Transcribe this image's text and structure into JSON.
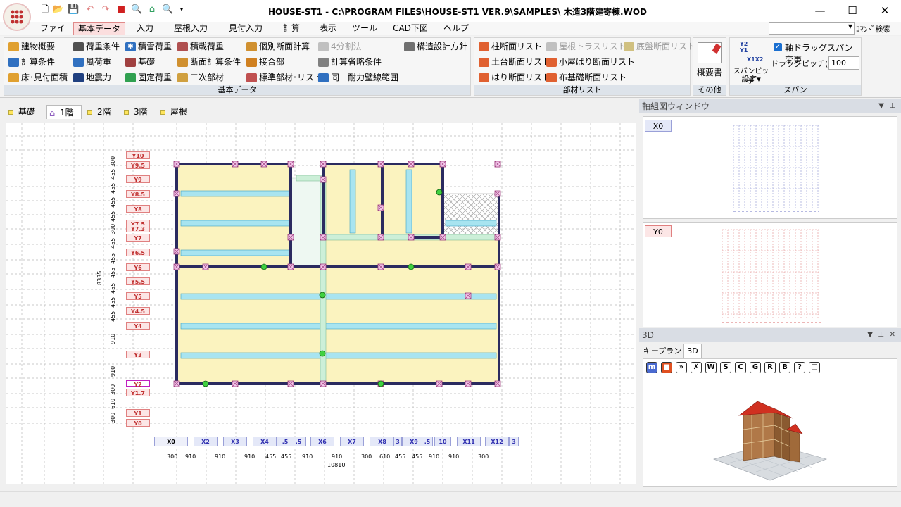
{
  "window": {
    "title": "HOUSE-ST1 - C:\\PROGRAM FILES\\HOUSE-ST1 VER.9\\SAMPLES\\ 木造3階建寄棟.WOD",
    "minimize": "—",
    "maximize": "☐",
    "close": "✕"
  },
  "menu": {
    "tabs": [
      "ファイル",
      "基本データ",
      "入力",
      "屋根入力",
      "見付入力",
      "計算",
      "表示",
      "ツール",
      "CAD下図",
      "ヘルプ"
    ],
    "active": "基本データ",
    "command_search": "ｺﾏﾝﾄﾞ検索"
  },
  "ribbon": {
    "basic_data": {
      "label": "基本データ",
      "items": [
        "建物概要",
        "荷重条件",
        "積雪荷重",
        "積載荷重",
        "個別断面計算",
        "4分割法",
        "構造設計方針",
        "計算条件",
        "風荷重",
        "基礎",
        "断面計算条件",
        "接合部",
        "計算省略条件",
        "床･見付面積",
        "地震力",
        "固定荷重",
        "二次部材",
        "標準部材･リスト",
        "同一耐力壁線範囲"
      ]
    },
    "member_list": {
      "label": "部材リスト",
      "items": [
        "柱断面リスト",
        "屋根トラスリスト",
        "底盤断面リスト",
        "土台断面リスト",
        "小屋ばり断面リスト",
        "はり断面リスト",
        "布基礎断面リスト"
      ]
    },
    "other": {
      "label": "その他",
      "summary_button": "概要書"
    },
    "span": {
      "label": "スパン",
      "pitch_button": "スパンピッチ",
      "pitch_button_2": "設定",
      "drag_checkbox": "軸ドラッグスパン変更",
      "drag_pitch_label": "ドラッグピッチ(mm)",
      "drag_pitch_value": "100",
      "icon_text_1": "Y2",
      "icon_text_2": "Y1",
      "icon_text_3": "X1X2"
    }
  },
  "floor_tabs": [
    "基礎",
    "1階",
    "2階",
    "3階",
    "屋根"
  ],
  "floor_active": "1階",
  "plan": {
    "y_labels": [
      "Y10",
      "Y9.5",
      "Y9",
      "Y8.5",
      "Y8",
      "Y7.5",
      "Y7.3",
      "Y7",
      "Y6.5",
      "Y6",
      "Y5.5",
      "Y5",
      "Y4.5",
      "Y4",
      "Y3",
      "Y2",
      "Y1.7",
      "Y1",
      "Y0"
    ],
    "y_dims": [
      "300",
      "455",
      "455",
      "455",
      "455",
      "300",
      "455",
      "455",
      "455",
      "455",
      "455",
      "455",
      "910",
      "910",
      "300",
      "610",
      "300"
    ],
    "y_total": "8335",
    "x_labels": [
      "X0",
      "X2",
      "X3",
      "X4",
      ".5",
      ".5",
      "X6",
      "X7",
      "X8",
      "3",
      "X9",
      ".5",
      "10",
      "X11",
      "X12",
      "3"
    ],
    "x_dims": [
      "300",
      "910",
      "910",
      "910",
      "455",
      "455",
      "910",
      "910",
      "300",
      "610",
      "455",
      "455",
      "910",
      "910",
      "300"
    ],
    "x_total": "10810"
  },
  "panels": {
    "axis_window": "軸組図ウィンドウ",
    "axis_x_tag": "X0",
    "axis_y_tag": "Y0",
    "three_d": "3D",
    "tabs": [
      "キープラン",
      "3D"
    ],
    "tab_active": "3D",
    "toolbar": [
      "m",
      "■",
      "»",
      "✗",
      "W",
      "S",
      "C",
      "G",
      "R",
      "B",
      "?",
      "□"
    ]
  }
}
